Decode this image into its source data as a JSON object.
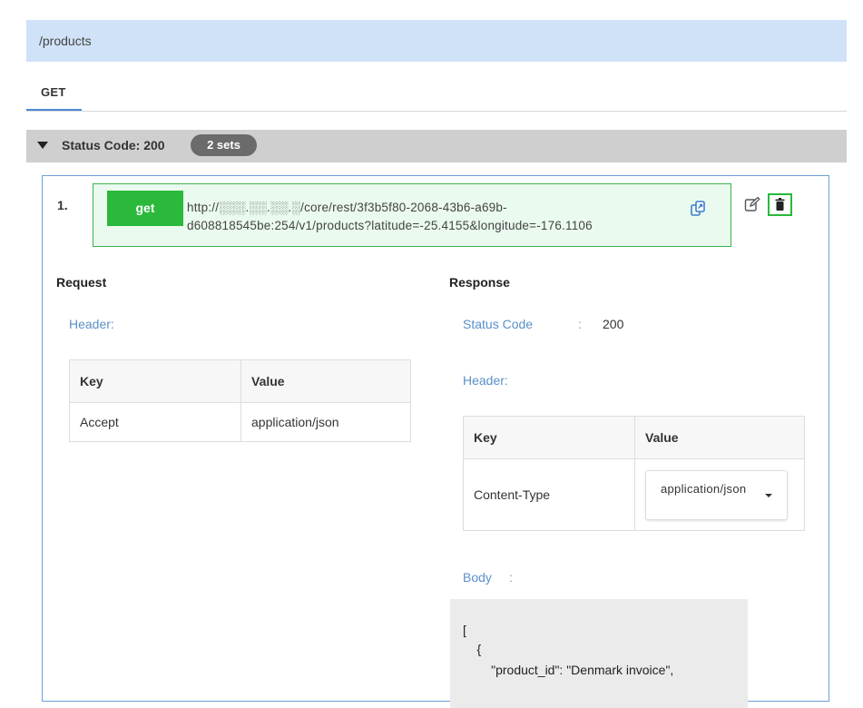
{
  "path": {
    "label": "/products"
  },
  "tabs": [
    {
      "label": "GET"
    }
  ],
  "status_group": {
    "label": "Status Code: 200",
    "badge": "2 sets"
  },
  "entry": {
    "number": "1.",
    "method": "get",
    "url_line1": "http://░░░.░░.░░.░/core/rest/3f3b5f80-2068-43b6-a69b-",
    "url_line2": "d608818545be:254/v1/products?latitude=-25.4155&longitude=-176.1106",
    "icons": {
      "copy": "copy-icon",
      "edit": "edit-icon",
      "delete": "trash-icon"
    },
    "colors": {
      "method_badge": "#2ab93a",
      "url_box_bg": "#eafaee",
      "link_blue": "#5a8fc9"
    }
  },
  "request": {
    "title": "Request",
    "header_label": "Header:",
    "table": {
      "headers": [
        "Key",
        "Value"
      ],
      "rows": [
        [
          "Accept",
          "application/json"
        ]
      ]
    }
  },
  "response": {
    "title": "Response",
    "status_label": "Status Code",
    "status_colon": ":",
    "status_value": "200",
    "header_label": "Header:",
    "table": {
      "headers": [
        "Key",
        "Value"
      ],
      "rows": [
        {
          "key": "Content-Type",
          "value": "application/json"
        }
      ]
    },
    "body_label": "Body",
    "body_colon": ":",
    "body_lines": [
      "[",
      "    {",
      "        \"product_id\": \"Denmark invoice\","
    ]
  }
}
